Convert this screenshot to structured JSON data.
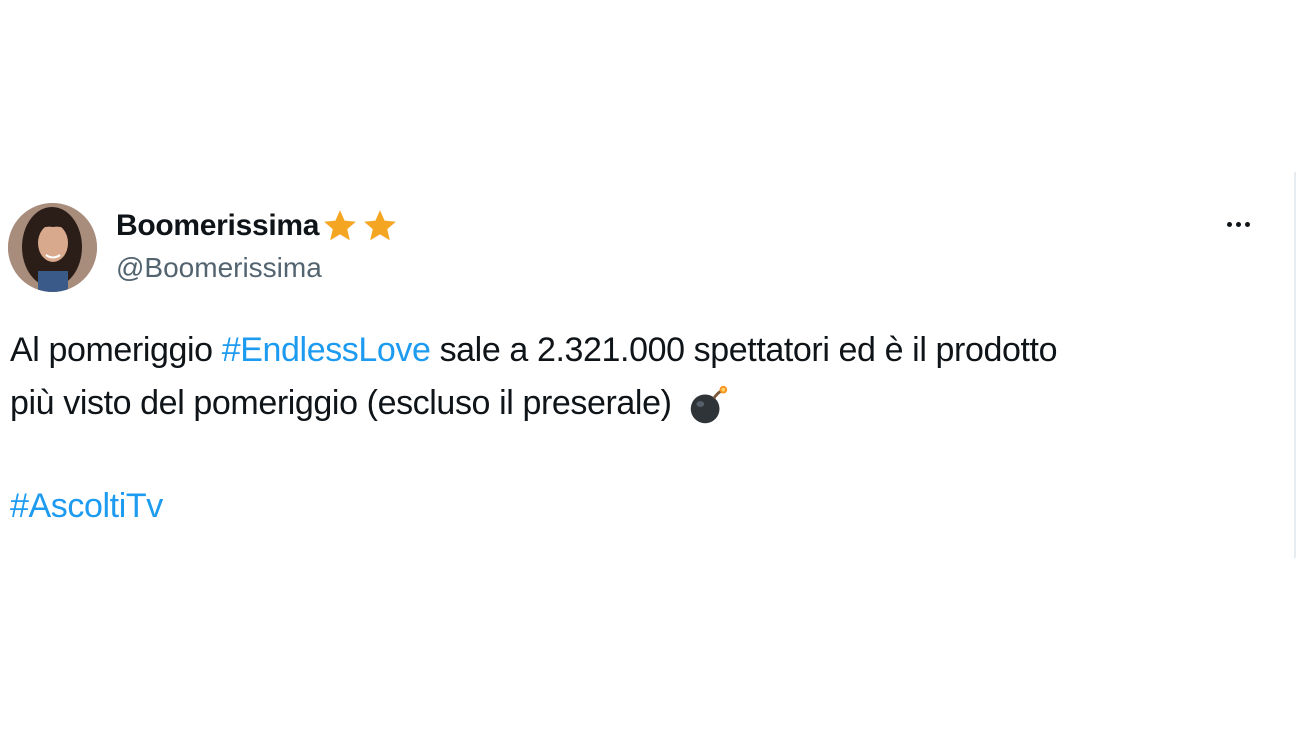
{
  "author": {
    "display_name": "Boomerissima",
    "handle": "@Boomerissima",
    "badges": [
      "star-icon",
      "star-icon"
    ],
    "badge_color": "#f4a623"
  },
  "tweet": {
    "line1_prefix": "Al pomeriggio ",
    "hashtag_1": "#EndlessLove",
    "line1_suffix": " sale a 2.321.000 spettatori ed è il prodotto",
    "line2": "più visto del pomeriggio (escluso il preserale)",
    "emoji": "bomb-icon",
    "hashtag_2": "#AscoltiTv"
  },
  "colors": {
    "text": "#0f1419",
    "secondary_text": "#536471",
    "link": "#1d9bf0"
  },
  "menu": {
    "icon": "more-options-icon"
  }
}
